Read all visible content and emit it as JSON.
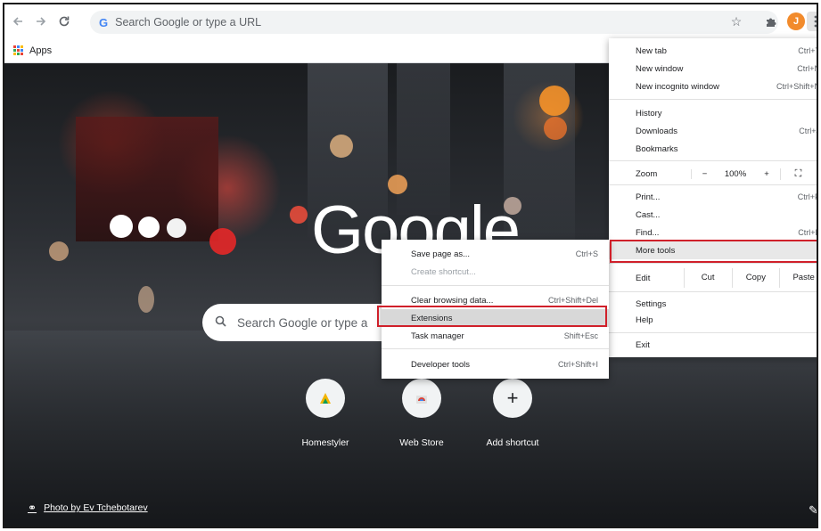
{
  "toolbar": {
    "back_icon": "arrow-left-icon",
    "forward_icon": "arrow-right-icon",
    "reload_icon": "reload-icon",
    "omnibox_placeholder": "Search Google or type a URL",
    "avatar_initial": "J",
    "bookmarks_apps_label": "Apps"
  },
  "ntp": {
    "logo_text": "Google",
    "search_placeholder": "Search Google or type a",
    "shortcuts": [
      {
        "label": "Homestyler"
      },
      {
        "label": "Web Store"
      },
      {
        "label": "Add shortcut"
      }
    ],
    "add_symbol": "+",
    "photo_credit": "Photo by Ev Tchebotarev"
  },
  "main_menu": {
    "new_tab": "New tab",
    "new_tab_sc": "Ctrl+T",
    "new_window": "New window",
    "new_window_sc": "Ctrl+N",
    "new_incognito": "New incognito window",
    "new_incognito_sc": "Ctrl+Shift+N",
    "history": "History",
    "downloads": "Downloads",
    "downloads_sc": "Ctrl+J",
    "bookmarks": "Bookmarks",
    "zoom": "Zoom",
    "zoom_minus": "−",
    "zoom_value": "100%",
    "zoom_plus": "+",
    "print": "Print...",
    "print_sc": "Ctrl+P",
    "cast": "Cast...",
    "find": "Find...",
    "find_sc": "Ctrl+F",
    "more_tools": "More tools",
    "edit": "Edit",
    "cut": "Cut",
    "copy": "Copy",
    "paste": "Paste",
    "settings": "Settings",
    "help": "Help",
    "exit": "Exit",
    "submenu_arrow": "›"
  },
  "sub_menu": {
    "save_page": "Save page as...",
    "save_page_sc": "Ctrl+S",
    "create_shortcut": "Create shortcut...",
    "clear_data": "Clear browsing data...",
    "clear_data_sc": "Ctrl+Shift+Del",
    "extensions": "Extensions",
    "task_manager": "Task manager",
    "task_manager_sc": "Shift+Esc",
    "developer_tools": "Developer tools",
    "developer_tools_sc": "Ctrl+Shift+I"
  },
  "colors": {
    "highlight_box": "#d0202a",
    "avatar": "#f28b2c"
  }
}
